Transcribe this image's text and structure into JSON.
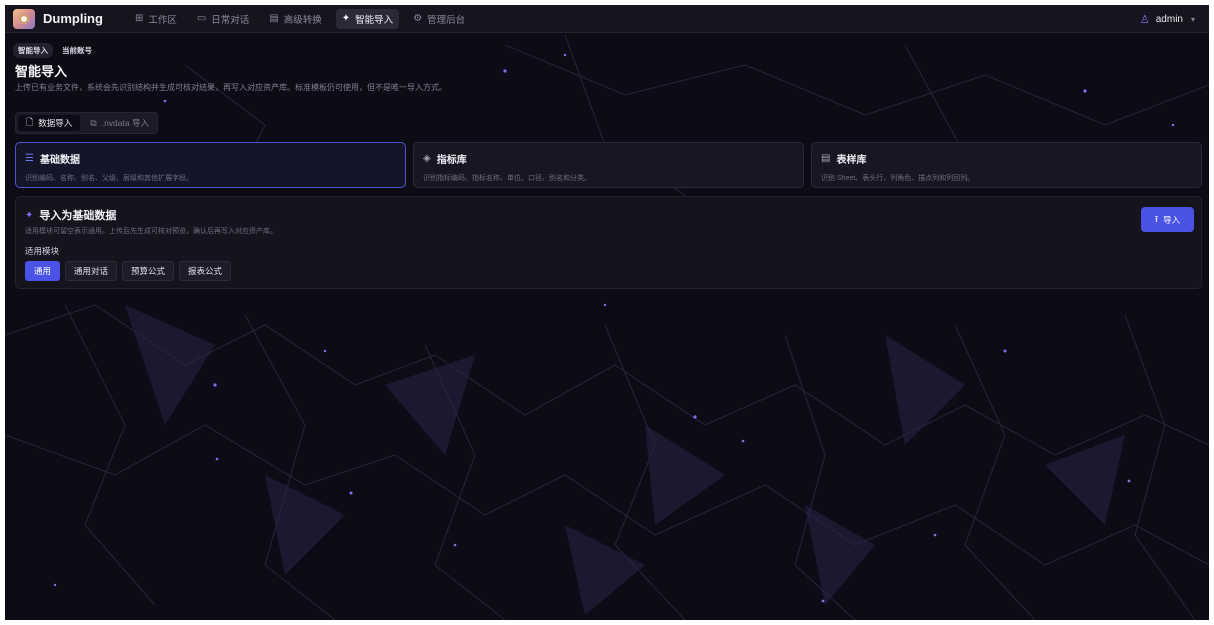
{
  "app": {
    "name": "Dumpling"
  },
  "nav": [
    {
      "label": "工作区",
      "icon": "grid-icon",
      "active": false
    },
    {
      "label": "日常对话",
      "icon": "chat-icon",
      "active": false
    },
    {
      "label": "高级转换",
      "icon": "document-icon",
      "active": false
    },
    {
      "label": "智能导入",
      "icon": "sparkle-icon",
      "active": true
    },
    {
      "label": "管理后台",
      "icon": "gear-icon",
      "active": false
    }
  ],
  "user": {
    "name": "admin"
  },
  "breadcrumb": [
    "智能导入",
    "当前账号"
  ],
  "page": {
    "title": "智能导入",
    "description": "上传已有业务文件，系统会先识别结构并生成可核对结果，再写入对应资产库。标准模板仍可使用，但不是唯一导入方式。"
  },
  "subtabs": [
    {
      "label": "数据导入",
      "icon": "file-icon",
      "active": true
    },
    {
      "label": ".nvdata 导入",
      "icon": "file-copy-icon",
      "active": false
    }
  ],
  "type_cards": [
    {
      "title": "基础数据",
      "description": "识别编码、名称、别名、父级、层级和其他扩展字段。",
      "icon": "list-icon",
      "active": true
    },
    {
      "title": "指标库",
      "description": "识别指标编码、指标名称、单位、口径、别名和分类。",
      "icon": "tag-icon",
      "active": false
    },
    {
      "title": "表样库",
      "description": "识别 Sheet、表头行、列角色、描点列和列回列。",
      "icon": "table-doc-icon",
      "active": false
    }
  ],
  "import_panel": {
    "title": "导入为基础数据",
    "description": "适用模块可留空表示通用。上传后先生成可核对预览，确认后再写入对应资产库。",
    "module_label": "适用模块",
    "modules": [
      {
        "label": "通用",
        "active": true
      },
      {
        "label": "通用对话",
        "active": false
      },
      {
        "label": "预算公式",
        "active": false
      },
      {
        "label": "报表公式",
        "active": false
      }
    ],
    "import_button": "导入"
  },
  "colors": {
    "background": "#0d0c16",
    "accent": "#4b53e6",
    "mesh_node": "#8a6cf0"
  }
}
